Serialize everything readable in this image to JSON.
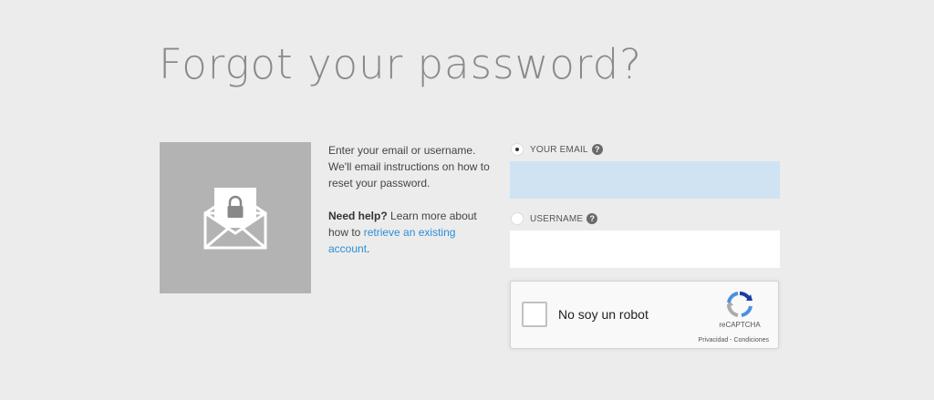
{
  "page": {
    "title": "Forgot your password?"
  },
  "illustration": {
    "icon": "envelope-lock-icon",
    "background_color": "#b3b3b3"
  },
  "info": {
    "instructions": "Enter your email or username. We'll email instructions on how to reset your password.",
    "help_strong": "Need help?",
    "help_text": " Learn more about how to ",
    "help_link": "retrieve an existing account",
    "help_end": ".",
    "link_color": "#2c8ed6"
  },
  "form": {
    "email": {
      "label": "YOUR EMAIL",
      "selected": true,
      "value": "",
      "help_icon": "?"
    },
    "username": {
      "label": "USERNAME",
      "selected": false,
      "value": "",
      "help_icon": "?"
    }
  },
  "recaptcha": {
    "label": "No soy un robot",
    "brand": "reCAPTCHA",
    "privacy": "Privacidad",
    "separator": " - ",
    "terms": "Condiciones"
  }
}
